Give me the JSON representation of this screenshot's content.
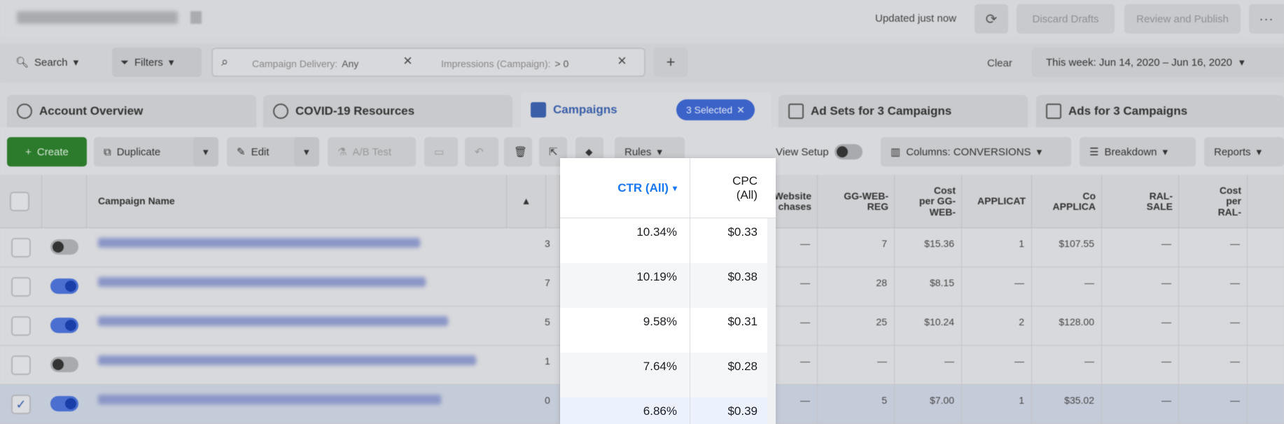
{
  "topbar": {
    "updated": "Updated just now",
    "discard": "Discard Drafts",
    "review": "Review and Publish",
    "more": "···"
  },
  "filterbar": {
    "search": "Search",
    "filters": "Filters",
    "chip1_label": "Campaign Delivery:",
    "chip1_value": "Any",
    "chip2_label": "Impressions (Campaign):",
    "chip2_value": "> 0",
    "clear": "Clear",
    "daterange": "This week: Jun 14, 2020 – Jun 16, 2020"
  },
  "tabs": {
    "account": "Account Overview",
    "covid": "COVID-19 Resources",
    "campaigns": "Campaigns",
    "selected": "3 Selected",
    "adsets": "Ad Sets for 3 Campaigns",
    "ads": "Ads for 3 Campaigns"
  },
  "toolbar": {
    "create": "Create",
    "duplicate": "Duplicate",
    "edit": "Edit",
    "abtest": "A/B Test",
    "rules": "Rules",
    "view_setup": "View Setup",
    "columns": "Columns: CONVERSIONS",
    "breakdown": "Breakdown",
    "reports": "Reports"
  },
  "table": {
    "headers": {
      "campaign_name": "Campaign Name",
      "website_purchases": "Website\nchases",
      "gg_web_reg": "GG-WEB-\nREG",
      "cost_gg": "Cost\nper GG-\nWEB-",
      "applicat": "APPLICAT",
      "cost_applica": "Co\nAPPLICA",
      "ral_sale": "RAL-\nSALE",
      "cost_ral": "Cost\nper\nRAL-"
    },
    "rows": [
      {
        "purch": "—",
        "gg": "7",
        "cost_gg": "$15.36",
        "app": "1",
        "cost_app": "$107.55",
        "ral": "—",
        "cost_ral": "—",
        "edge": "3"
      },
      {
        "purch": "—",
        "gg": "28",
        "cost_gg": "$8.15",
        "app": "—",
        "cost_app": "—",
        "ral": "—",
        "cost_ral": "—",
        "edge": "7"
      },
      {
        "purch": "—",
        "gg": "25",
        "cost_gg": "$10.24",
        "app": "2",
        "cost_app": "$128.00",
        "ral": "—",
        "cost_ral": "—",
        "edge": "5"
      },
      {
        "purch": "—",
        "gg": "—",
        "cost_gg": "—",
        "app": "—",
        "cost_app": "—",
        "ral": "—",
        "cost_ral": "—",
        "edge": "1"
      },
      {
        "purch": "—",
        "gg": "5",
        "cost_gg": "$7.00",
        "app": "1",
        "cost_app": "$35.02",
        "ral": "—",
        "cost_ral": "—",
        "edge": "0"
      }
    ]
  },
  "panel": {
    "ctr_header": "CTR (All)",
    "cpc_header": "CPC\n(All)",
    "rows": [
      {
        "ctr": "10.34%",
        "cpc": "$0.33"
      },
      {
        "ctr": "10.19%",
        "cpc": "$0.38"
      },
      {
        "ctr": "9.58%",
        "cpc": "$0.31"
      },
      {
        "ctr": "7.64%",
        "cpc": "$0.28"
      },
      {
        "ctr": "6.86%",
        "cpc": "$0.39"
      }
    ]
  }
}
